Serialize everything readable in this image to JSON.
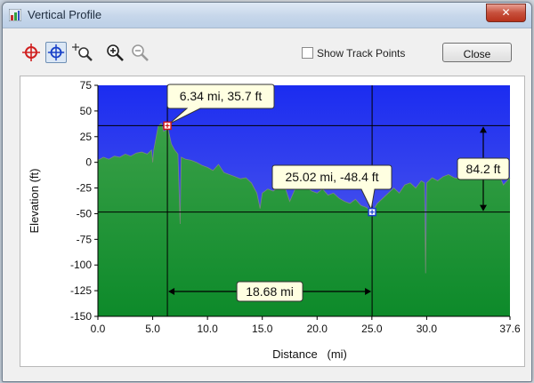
{
  "window": {
    "title": "Vertical Profile",
    "close_glyph": "✕"
  },
  "toolbar": {
    "tools": [
      {
        "name": "crosshair-red-icon",
        "active": false
      },
      {
        "name": "crosshair-blue-icon",
        "active": true
      },
      {
        "name": "zoom-rect-icon",
        "active": false
      },
      {
        "name": "zoom-in-icon",
        "active": false
      },
      {
        "name": "zoom-out-icon",
        "active": false
      }
    ],
    "show_track_points_label": "Show Track Points",
    "show_track_points_checked": false,
    "close_label": "Close"
  },
  "chart_data": {
    "type": "area",
    "xlabel": "Distance   (mi)",
    "ylabel": "Elevation (ft)",
    "xlim": [
      0,
      37.6
    ],
    "ylim": [
      -150,
      75
    ],
    "x_ticks": [
      "0.0",
      "5.0",
      "10.0",
      "15.0",
      "20.0",
      "25.0",
      "30.0",
      "37.6"
    ],
    "x_tick_values": [
      0,
      5,
      10,
      15,
      20,
      25,
      30,
      37.6
    ],
    "y_ticks": [
      "75",
      "50",
      "25",
      "0",
      "-25",
      "-50",
      "-75",
      "-100",
      "-125",
      "-150"
    ],
    "y_tick_values": [
      75,
      50,
      25,
      0,
      -25,
      -50,
      -75,
      -100,
      -125,
      -150
    ],
    "colors": {
      "sky": "#1b2cf0",
      "sky_low": "#5a62ee",
      "ground_top": "#3aa048",
      "ground_bottom": "#0f8a2a"
    },
    "profile": [
      [
        0,
        2
      ],
      [
        0.5,
        5
      ],
      [
        1,
        3
      ],
      [
        1.5,
        6
      ],
      [
        2,
        5
      ],
      [
        2.5,
        8
      ],
      [
        3,
        6
      ],
      [
        3.5,
        9
      ],
      [
        4,
        10
      ],
      [
        4.5,
        8
      ],
      [
        4.9,
        12
      ],
      [
        5.0,
        0
      ],
      [
        5.1,
        12
      ],
      [
        5.5,
        35
      ],
      [
        5.8,
        38
      ],
      [
        6.0,
        30
      ],
      [
        6.3,
        32
      ],
      [
        6.34,
        35.7
      ],
      [
        6.5,
        28
      ],
      [
        6.7,
        18
      ],
      [
        7.0,
        12
      ],
      [
        7.3,
        8
      ],
      [
        7.5,
        -60
      ],
      [
        7.6,
        5
      ],
      [
        8.0,
        3
      ],
      [
        8.5,
        2
      ],
      [
        9.0,
        0
      ],
      [
        9.5,
        -3
      ],
      [
        10.0,
        -5
      ],
      [
        10.5,
        -8
      ],
      [
        11.0,
        -2
      ],
      [
        11.5,
        -10
      ],
      [
        12.0,
        -12
      ],
      [
        12.5,
        -14
      ],
      [
        13.0,
        -16
      ],
      [
        13.5,
        -15
      ],
      [
        14.0,
        -20
      ],
      [
        14.5,
        -30
      ],
      [
        14.8,
        -45
      ],
      [
        15.0,
        -30
      ],
      [
        15.5,
        -26
      ],
      [
        16.0,
        -28
      ],
      [
        16.5,
        -24
      ],
      [
        17.0,
        -22
      ],
      [
        17.5,
        -38
      ],
      [
        18.0,
        -26
      ],
      [
        18.5,
        -22
      ],
      [
        19.0,
        -24
      ],
      [
        19.5,
        -28
      ],
      [
        20.0,
        -30
      ],
      [
        20.5,
        -26
      ],
      [
        21.0,
        -32
      ],
      [
        21.5,
        -30
      ],
      [
        22.0,
        -35
      ],
      [
        22.5,
        -38
      ],
      [
        23.0,
        -40
      ],
      [
        23.5,
        -36
      ],
      [
        24.0,
        -42
      ],
      [
        24.5,
        -44
      ],
      [
        25.02,
        -48.4
      ],
      [
        25.5,
        -40
      ],
      [
        26.0,
        -35
      ],
      [
        26.5,
        -30
      ],
      [
        27.0,
        -25
      ],
      [
        27.5,
        -30
      ],
      [
        28.0,
        -22
      ],
      [
        28.5,
        -20
      ],
      [
        29.0,
        -25
      ],
      [
        29.5,
        -18
      ],
      [
        29.8,
        -20
      ],
      [
        29.9,
        -108
      ],
      [
        30.0,
        -20
      ],
      [
        30.5,
        -15
      ],
      [
        31.0,
        -18
      ],
      [
        31.5,
        -14
      ],
      [
        32.0,
        -12
      ],
      [
        32.5,
        -15
      ],
      [
        33.0,
        -16
      ],
      [
        33.5,
        -10
      ],
      [
        34.0,
        -14
      ],
      [
        34.5,
        -15
      ],
      [
        35.0,
        -12
      ],
      [
        35.5,
        -14
      ],
      [
        36.0,
        -15
      ],
      [
        36.5,
        -10
      ],
      [
        37.0,
        -22
      ],
      [
        37.6,
        -15
      ]
    ],
    "markers": [
      {
        "x": 6.34,
        "y": 35.7,
        "label": "6.34 mi, 35.7 ft",
        "color": "#d01818"
      },
      {
        "x": 25.02,
        "y": -48.4,
        "label": "25.02 mi, -48.4 ft",
        "color": "#1a3cd0"
      }
    ],
    "distance_label": "18.68 mi",
    "elevation_diff_label": "84.2 ft",
    "grid": false,
    "legend": "none"
  }
}
